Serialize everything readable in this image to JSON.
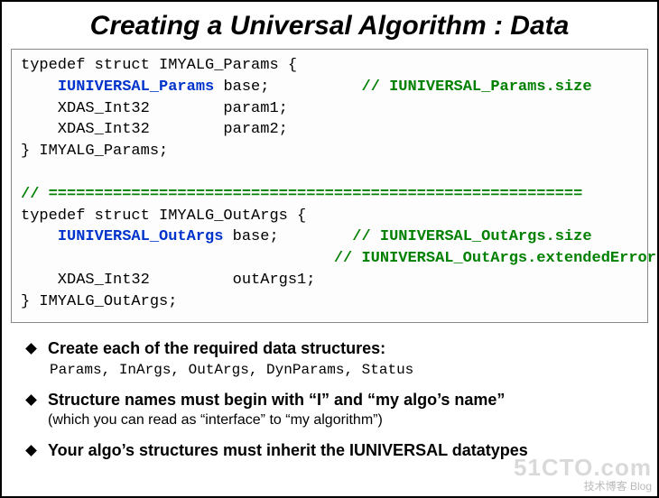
{
  "title": "Creating a Universal Algorithm : Data",
  "code": {
    "struct1_open": "typedef struct IMYALG_Params {",
    "struct1_base_type": "IUNIVERSAL_Params",
    "struct1_base_name": " base;",
    "struct1_base_comment": "// IUNIVERSAL_Params.size",
    "struct1_f1": "    XDAS_Int32        param1;",
    "struct1_f2": "    XDAS_Int32        param2;",
    "struct1_close": "} IMYALG_Params;",
    "divider": "// ==========================================================",
    "struct2_open": "typedef struct IMYALG_OutArgs {",
    "struct2_base_type": "IUNIVERSAL_OutArgs",
    "struct2_base_name": " base;",
    "struct2_base_comment1": "// IUNIVERSAL_OutArgs.size",
    "struct2_base_comment2": "// IUNIVERSAL_OutArgs.extendedError",
    "struct2_f1": "    XDAS_Int32         outArgs1;",
    "struct2_close": "} IMYALG_OutArgs;"
  },
  "bullets": {
    "b1": "Create each of the required data structures:",
    "b1_mono": "Params, InArgs, OutArgs, DynParams, Status",
    "b2": "Structure names must begin with “I” and “my algo’s name”",
    "b2_sub": "(which you can read as “interface” to “my algorithm”)",
    "b3": "Your algo’s structures must inherit the IUNIVERSAL datatypes"
  },
  "watermark": {
    "brand": "51CTO.com",
    "tag": "技术博客   Blog"
  }
}
